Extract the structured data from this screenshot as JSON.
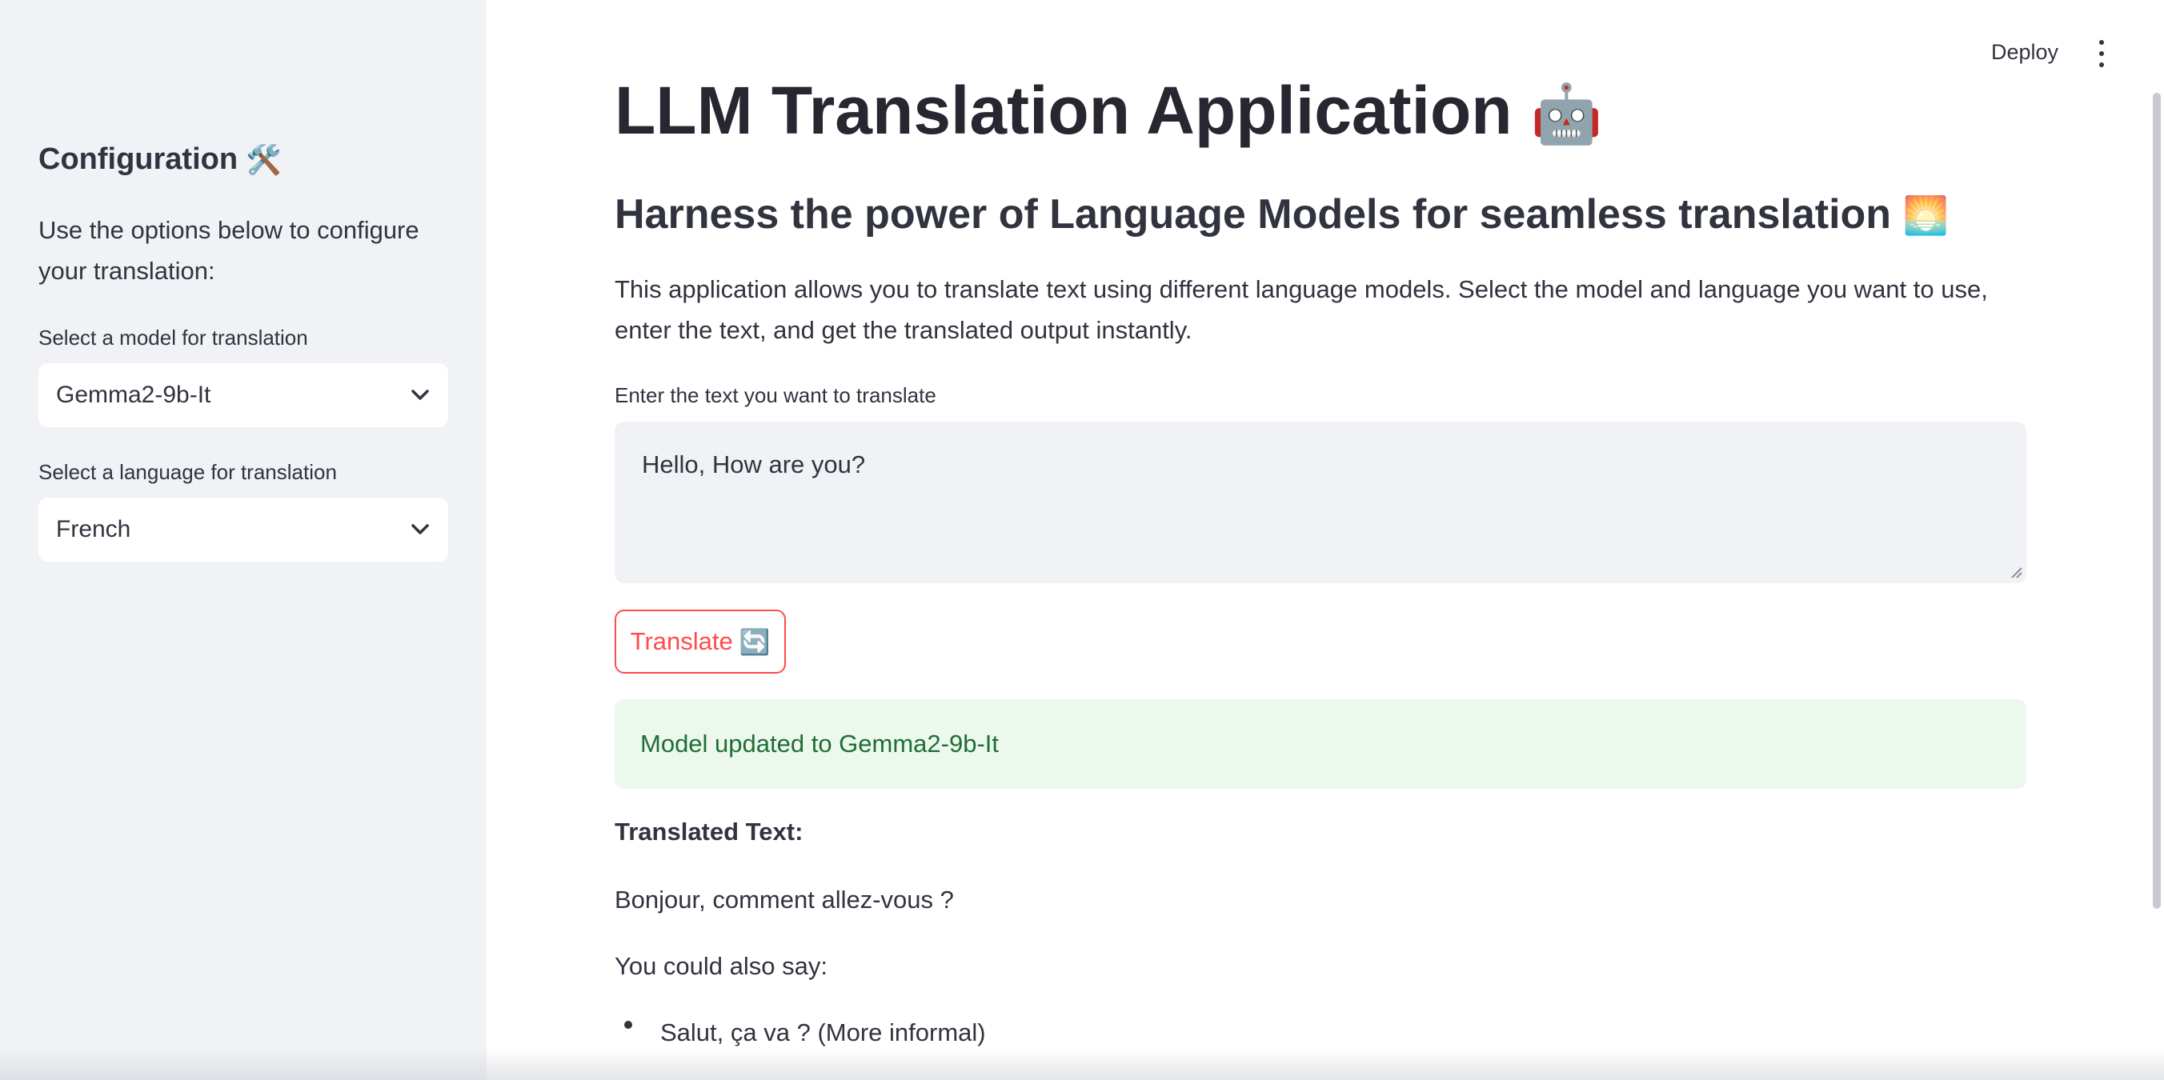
{
  "sidebar": {
    "header": "Configuration",
    "header_emoji": "🛠️",
    "description": "Use the options below to configure your translation:",
    "model_label": "Select a model for translation",
    "model_value": "Gemma2-9b-It",
    "language_label": "Select a language for translation",
    "language_value": "French"
  },
  "toolbar": {
    "deploy_label": "Deploy"
  },
  "main": {
    "title": "LLM Translation Application",
    "title_emoji": "🤖",
    "subtitle": "Harness the power of Language Models for seamless translation",
    "subtitle_emoji": "🌅",
    "description": "This application allows you to translate text using different language models. Select the model and language you want to use, enter the text, and get the translated output instantly.",
    "input_label": "Enter the text you want to translate",
    "input_value": "Hello, How are you?",
    "translate_label": "Translate",
    "translate_emoji": "🔄",
    "alert_text": "Model updated to Gemma2-9b-It",
    "output_heading": "Translated Text:",
    "output_line1": "Bonjour, comment allez-vous ?",
    "output_line2": "You could also say:",
    "output_bullet1": "Salut, ça va ? (More informal)"
  },
  "colors": {
    "sidebar_bg": "#f0f2f6",
    "accent": "#ff4b4b",
    "success_bg": "#ecf8ee",
    "success_text": "#1e6e34"
  }
}
